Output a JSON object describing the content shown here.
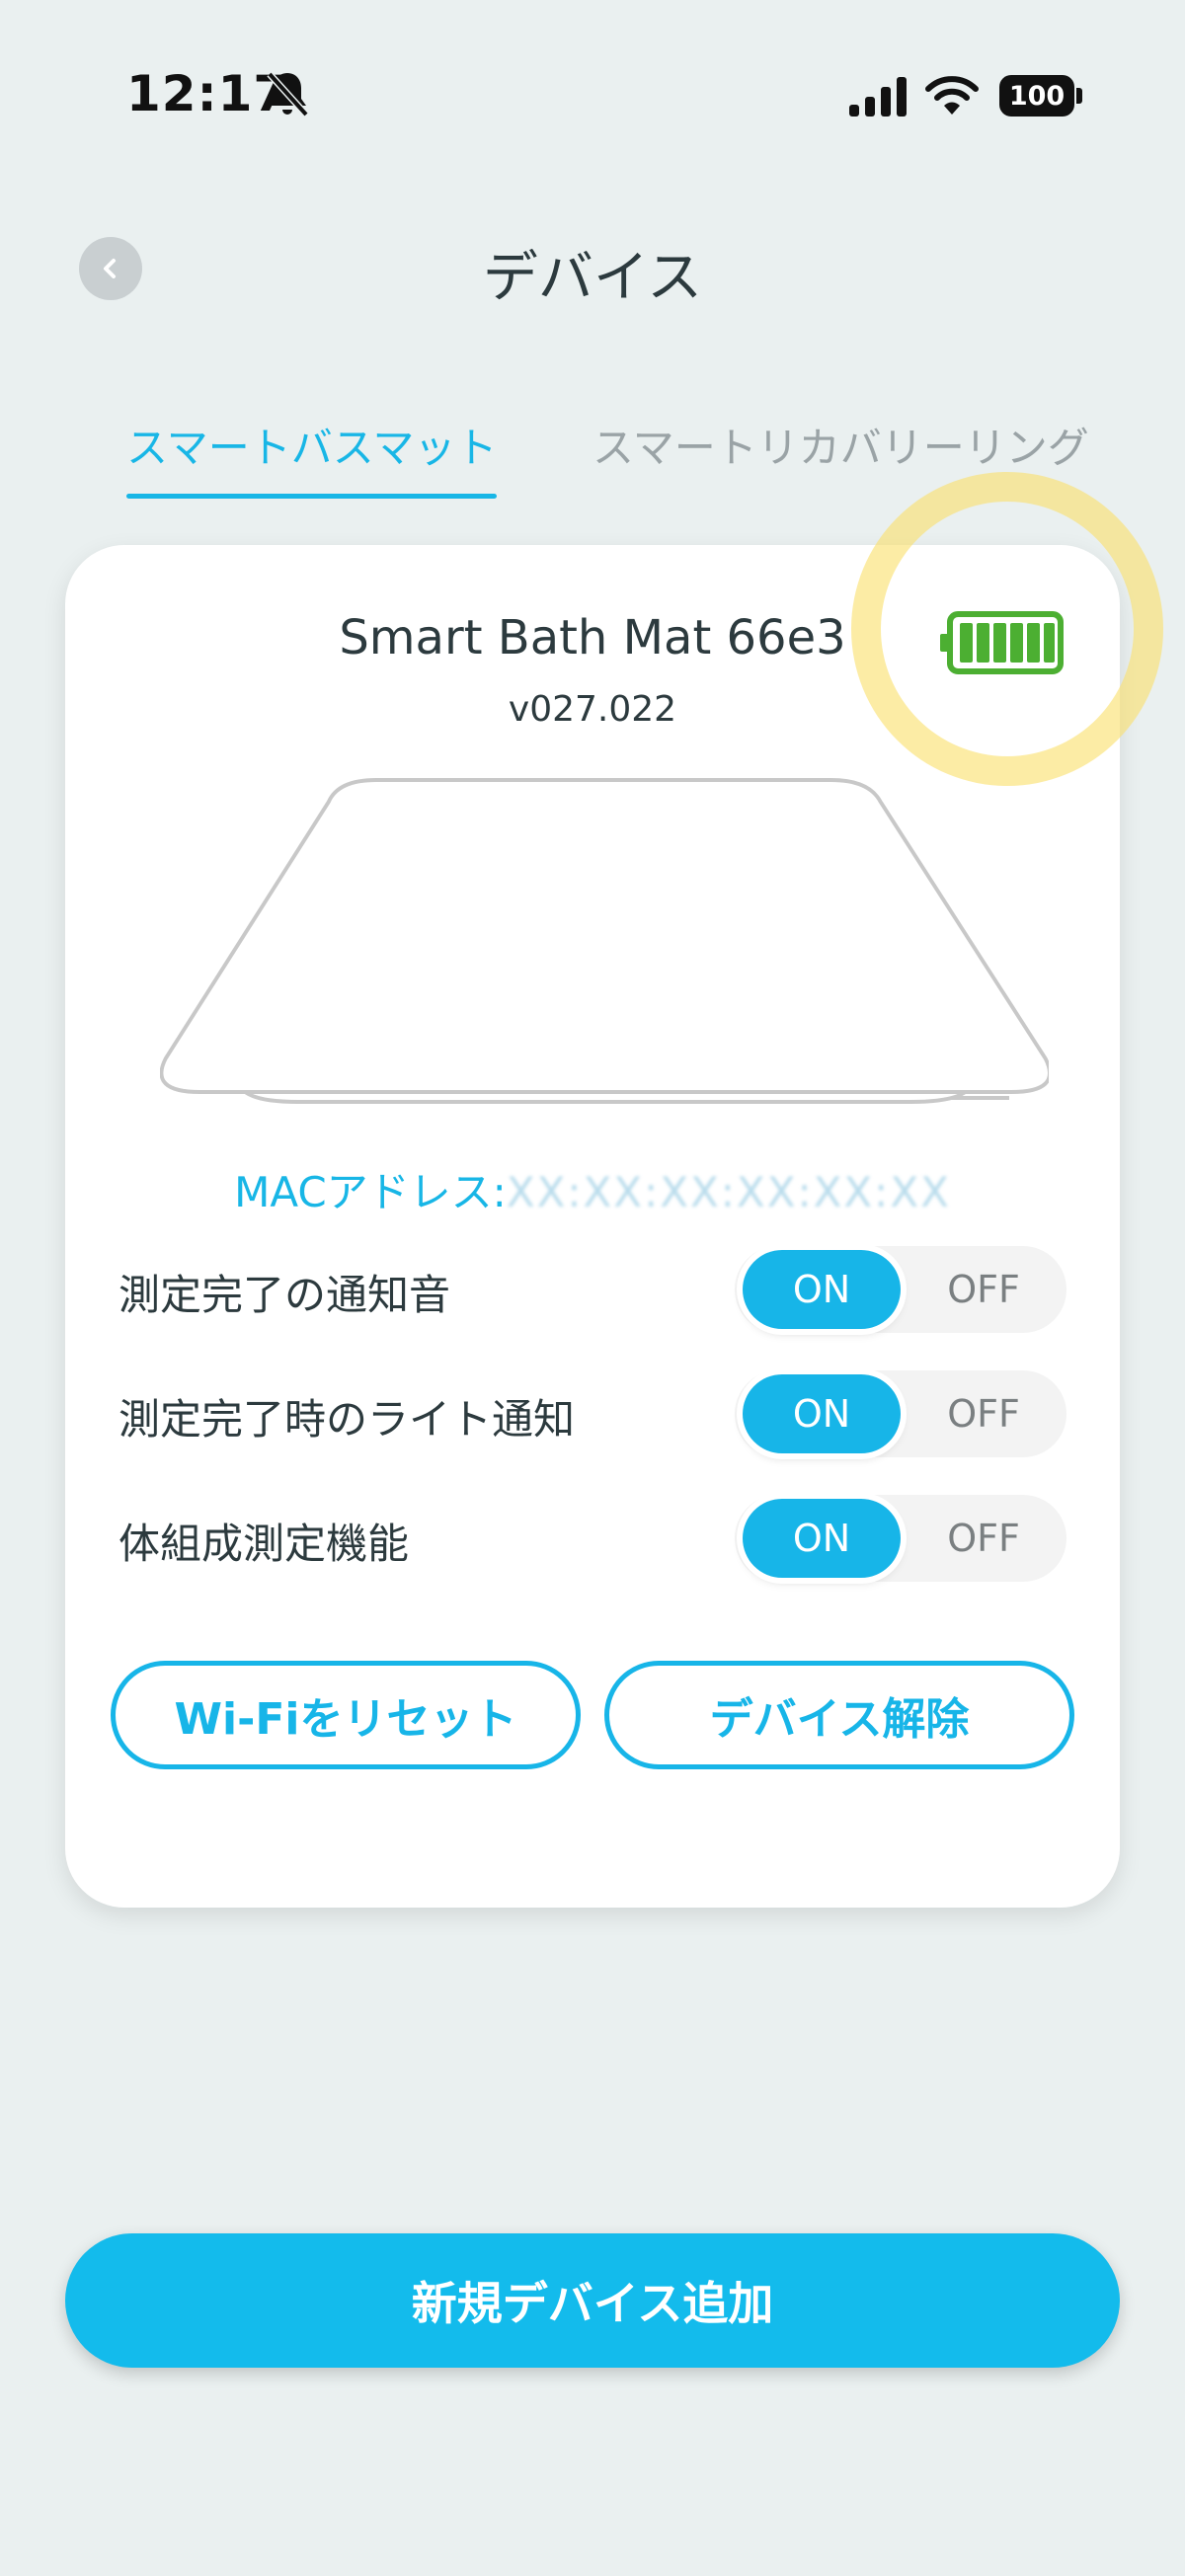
{
  "status_bar": {
    "time": "12:17",
    "battery": "100",
    "icons": [
      "bell-slash-icon",
      "signal-icon",
      "wifi-icon",
      "battery-icon"
    ]
  },
  "header": {
    "title": "デバイス",
    "back_icon": "chevron-left-icon"
  },
  "tabs": [
    {
      "label": "スマートバスマット",
      "active": true
    },
    {
      "label": "スマートリカバリーリング",
      "active": false
    }
  ],
  "device": {
    "name": "Smart Bath Mat 66e3",
    "version": "v027.022",
    "battery_icon": "battery-full-icon",
    "battery_level": 1.0,
    "mac_label": "MACアドレス:",
    "mac_value": "XX:XX:XX:XX:XX:XX",
    "settings": [
      {
        "label": "測定完了の通知音",
        "on_label": "ON",
        "off_label": "OFF",
        "value": "ON"
      },
      {
        "label": "測定完了時のライト通知",
        "on_label": "ON",
        "off_label": "OFF",
        "value": "ON"
      },
      {
        "label": "体組成測定機能",
        "on_label": "ON",
        "off_label": "OFF",
        "value": "ON"
      }
    ],
    "reset_wifi_label": "Wi-Fiをリセット",
    "remove_device_label": "デバイス解除"
  },
  "add_device_label": "新規デバイス追加",
  "colors": {
    "accent": "#17b5e8",
    "background": "#eaf0f0",
    "battery_green": "#4caf32",
    "annotation_highlight": "#f8df74"
  }
}
